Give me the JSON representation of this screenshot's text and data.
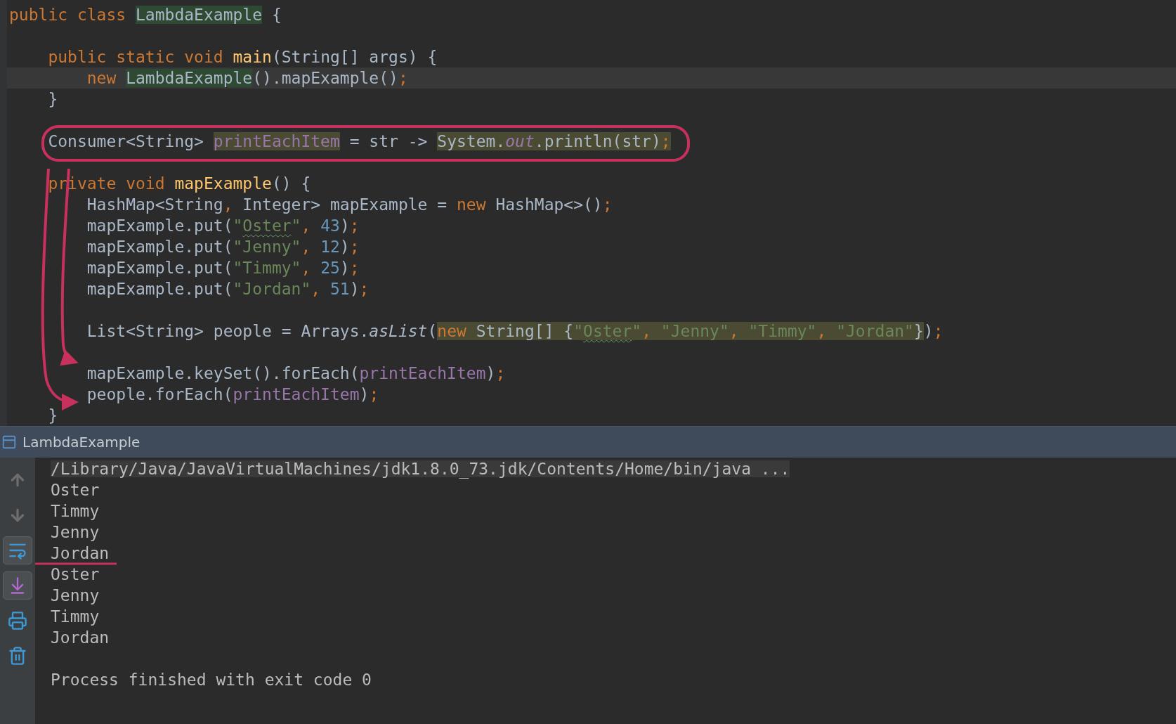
{
  "code": {
    "lines": [
      {
        "kind": "code",
        "current": false,
        "tokens": [
          {
            "text": "public class ",
            "kind": "keyword"
          },
          {
            "text": "LambdaExample",
            "kind": "plain",
            "usage": true
          },
          {
            "text": " {",
            "kind": "plain"
          }
        ]
      },
      {
        "kind": "blank",
        "current": false
      },
      {
        "kind": "code",
        "current": false,
        "tokens": [
          {
            "text": "    public static void ",
            "kind": "keyword"
          },
          {
            "text": "main",
            "kind": "declaration"
          },
          {
            "text": "(String[] args) {",
            "kind": "plain"
          }
        ]
      },
      {
        "kind": "code",
        "current": true,
        "tokens": [
          {
            "text": "        new ",
            "kind": "keyword"
          },
          {
            "text": "LambdaExample",
            "kind": "plain",
            "usage": true
          },
          {
            "text": "().mapExample()",
            "kind": "plain"
          },
          {
            "text": ";",
            "kind": "punct"
          }
        ]
      },
      {
        "kind": "code",
        "current": false,
        "tokens": [
          {
            "text": "    }",
            "kind": "plain"
          }
        ]
      },
      {
        "kind": "blank",
        "current": false
      },
      {
        "kind": "code",
        "current": false,
        "tokens": [
          {
            "text": "    Consumer<String> ",
            "kind": "plain"
          },
          {
            "text": "printEachItem",
            "kind": "field",
            "highlighted": true
          },
          {
            "text": " = str -> ",
            "kind": "plain"
          },
          {
            "text": "System.",
            "kind": "plain",
            "highlighted": true
          },
          {
            "text": "out",
            "kind": "static_field",
            "highlighted": true
          },
          {
            "text": ".println(str)",
            "kind": "plain",
            "highlighted": true
          },
          {
            "text": ";",
            "kind": "punct",
            "highlighted": true
          }
        ]
      },
      {
        "kind": "blank",
        "current": false
      },
      {
        "kind": "code",
        "current": false,
        "tokens": [
          {
            "text": "    private void ",
            "kind": "keyword"
          },
          {
            "text": "mapExample",
            "kind": "declaration"
          },
          {
            "text": "() {",
            "kind": "plain"
          }
        ]
      },
      {
        "kind": "code",
        "current": false,
        "tokens": [
          {
            "text": "        HashMap<String",
            "kind": "plain"
          },
          {
            "text": ",",
            "kind": "punct"
          },
          {
            "text": " Integer> mapExample = ",
            "kind": "plain"
          },
          {
            "text": "new ",
            "kind": "keyword"
          },
          {
            "text": "HashMap<>()",
            "kind": "plain"
          },
          {
            "text": ";",
            "kind": "punct"
          }
        ]
      },
      {
        "kind": "code",
        "current": false,
        "tokens": [
          {
            "text": "        mapExample.put(",
            "kind": "plain"
          },
          {
            "text": "\"",
            "kind": "string"
          },
          {
            "text": "Oster",
            "kind": "string",
            "typo": true
          },
          {
            "text": "\"",
            "kind": "string"
          },
          {
            "text": ",",
            "kind": "punct"
          },
          {
            "text": " 43",
            "kind": "number"
          },
          {
            "text": ")",
            "kind": "plain"
          },
          {
            "text": ";",
            "kind": "punct"
          }
        ]
      },
      {
        "kind": "code",
        "current": false,
        "tokens": [
          {
            "text": "        mapExample.put(",
            "kind": "plain"
          },
          {
            "text": "\"Jenny\"",
            "kind": "string"
          },
          {
            "text": ",",
            "kind": "punct"
          },
          {
            "text": " 12",
            "kind": "number"
          },
          {
            "text": ")",
            "kind": "plain"
          },
          {
            "text": ";",
            "kind": "punct"
          }
        ]
      },
      {
        "kind": "code",
        "current": false,
        "tokens": [
          {
            "text": "        mapExample.put(",
            "kind": "plain"
          },
          {
            "text": "\"Timmy\"",
            "kind": "string"
          },
          {
            "text": ",",
            "kind": "punct"
          },
          {
            "text": " 25",
            "kind": "number"
          },
          {
            "text": ")",
            "kind": "plain"
          },
          {
            "text": ";",
            "kind": "punct"
          }
        ]
      },
      {
        "kind": "code",
        "current": false,
        "tokens": [
          {
            "text": "        mapExample.put(",
            "kind": "plain"
          },
          {
            "text": "\"Jordan\"",
            "kind": "string"
          },
          {
            "text": ",",
            "kind": "punct"
          },
          {
            "text": " 51",
            "kind": "number"
          },
          {
            "text": ")",
            "kind": "plain"
          },
          {
            "text": ";",
            "kind": "punct"
          }
        ]
      },
      {
        "kind": "blank",
        "current": false
      },
      {
        "kind": "code",
        "current": false,
        "tokens": [
          {
            "text": "        List<String> people = Arrays.",
            "kind": "plain"
          },
          {
            "text": "asList",
            "kind": "static_method"
          },
          {
            "text": "(",
            "kind": "plain"
          },
          {
            "text": "new ",
            "kind": "keyword",
            "highlighted": true
          },
          {
            "text": "String[] {",
            "kind": "plain",
            "highlighted": true
          },
          {
            "text": "\"",
            "kind": "string",
            "highlighted": true
          },
          {
            "text": "Oster",
            "kind": "string",
            "highlighted": true,
            "typo": true
          },
          {
            "text": "\"",
            "kind": "string",
            "highlighted": true
          },
          {
            "text": ",",
            "kind": "punct",
            "highlighted": true
          },
          {
            "text": " \"Jenny\"",
            "kind": "string",
            "highlighted": true
          },
          {
            "text": ",",
            "kind": "punct",
            "highlighted": true
          },
          {
            "text": " \"Timmy\"",
            "kind": "string",
            "highlighted": true
          },
          {
            "text": ",",
            "kind": "punct",
            "highlighted": true
          },
          {
            "text": " \"Jordan\"",
            "kind": "string",
            "highlighted": true
          },
          {
            "text": "}",
            "kind": "plain",
            "highlighted": true
          },
          {
            "text": ")",
            "kind": "plain"
          },
          {
            "text": ";",
            "kind": "punct"
          }
        ]
      },
      {
        "kind": "blank",
        "current": false
      },
      {
        "kind": "code",
        "current": false,
        "tokens": [
          {
            "text": "        mapExample.keySet().forEach(",
            "kind": "plain"
          },
          {
            "text": "printEachItem",
            "kind": "field"
          },
          {
            "text": ")",
            "kind": "plain"
          },
          {
            "text": ";",
            "kind": "punct"
          }
        ]
      },
      {
        "kind": "code",
        "current": false,
        "tokens": [
          {
            "text": "        people.forEach(",
            "kind": "plain"
          },
          {
            "text": "printEachItem",
            "kind": "field"
          },
          {
            "text": ")",
            "kind": "plain"
          },
          {
            "text": ";",
            "kind": "punct"
          }
        ]
      },
      {
        "kind": "code",
        "current": false,
        "tokens": [
          {
            "text": "    }",
            "kind": "plain"
          }
        ]
      }
    ]
  },
  "run_panel": {
    "title": "LambdaExample",
    "console": [
      {
        "kind": "command",
        "text": "/Library/Java/JavaVirtualMachines/jdk1.8.0_73.jdk/Contents/Home/bin/java ..."
      },
      {
        "kind": "output",
        "text": "Oster"
      },
      {
        "kind": "output",
        "text": "Timmy"
      },
      {
        "kind": "output",
        "text": "Jenny"
      },
      {
        "kind": "output",
        "text": "Jordan"
      },
      {
        "kind": "output",
        "text": "Oster"
      },
      {
        "kind": "output",
        "text": "Jenny"
      },
      {
        "kind": "output",
        "text": "Timmy"
      },
      {
        "kind": "output",
        "text": "Jordan"
      },
      {
        "kind": "blank"
      },
      {
        "kind": "output",
        "text": "Process finished with exit code 0"
      }
    ]
  }
}
